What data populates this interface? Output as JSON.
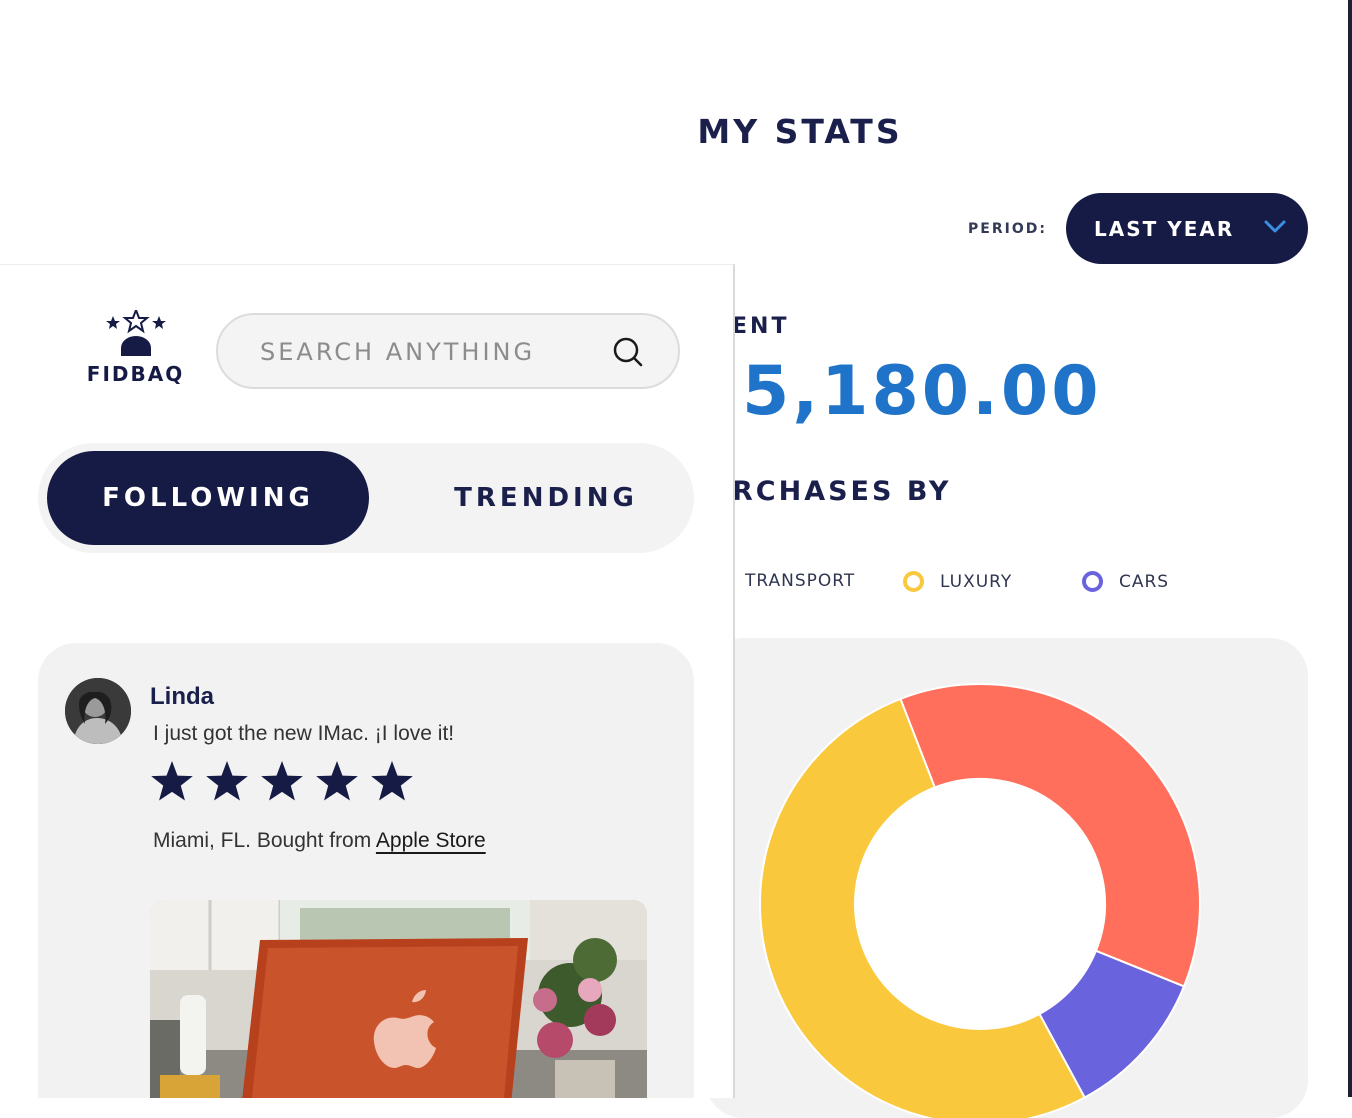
{
  "stats": {
    "title": "MY STATS",
    "period_label": "PERIOD:",
    "period_value": "LAST YEAR",
    "spent_label_partial": "ENT",
    "spent_amount_partial": "5,180.00",
    "purchases_label_partial": "RCHASES BY",
    "legend": [
      {
        "label": "TRANSPORT",
        "color": "#ff6f5b"
      },
      {
        "label": "LUXURY",
        "color": "#f9c83c"
      },
      {
        "label": "CARS",
        "color": "#6a63de"
      }
    ],
    "accent_color": "#1f74c9",
    "brand_dark": "#161b45"
  },
  "chart_data": {
    "type": "pie",
    "variant": "donut",
    "series": [
      {
        "name": "TRANSPORT",
        "value": 37,
        "color": "#ff6f5b"
      },
      {
        "name": "CARS",
        "value": 11,
        "color": "#6a63de"
      },
      {
        "name": "LUXURY",
        "value": 52,
        "color": "#f9c83c"
      }
    ]
  },
  "feed": {
    "logo_text": "FIDBAQ",
    "search_placeholder": "SEARCH ANYTHING",
    "tabs": [
      {
        "label": "FOLLOWING",
        "active": true
      },
      {
        "label": "TRENDING",
        "active": false
      }
    ],
    "post": {
      "author": "Linda",
      "text": "I just got the new IMac. ¡I love it!",
      "rating": 5,
      "rating_max": 5,
      "location_prefix": "Miami, FL. Bought from ",
      "store": "Apple Store"
    }
  }
}
